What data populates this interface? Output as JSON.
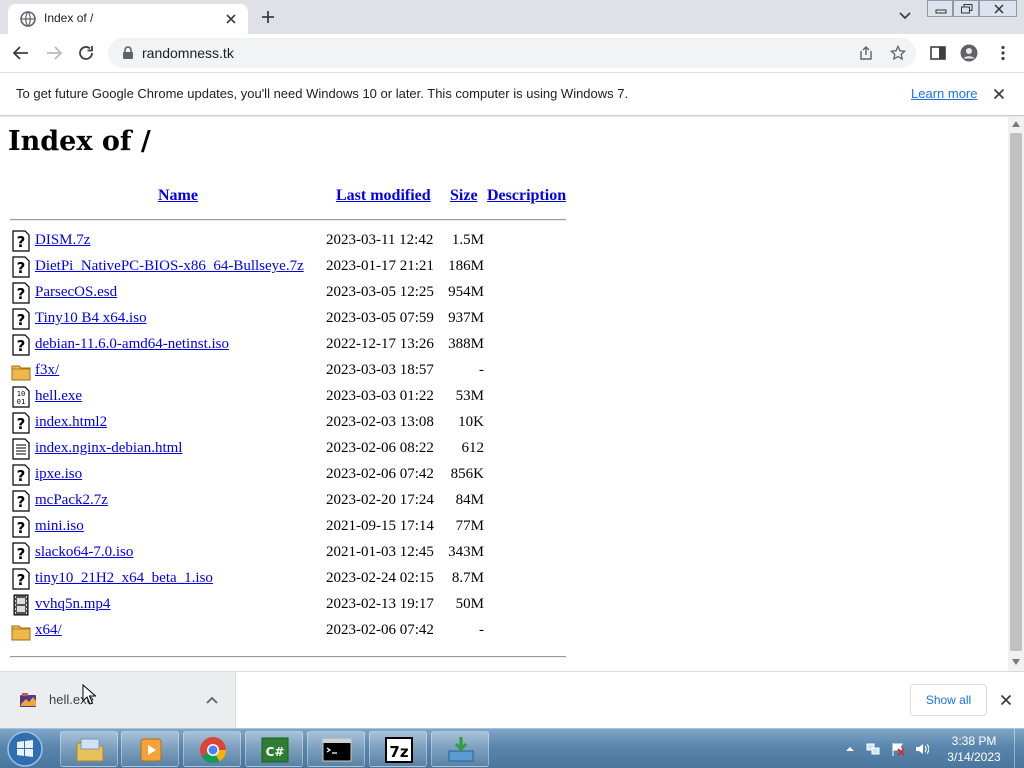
{
  "browser": {
    "tab": {
      "title": "Index of /",
      "favicon": "globe-icon"
    },
    "address_bar": {
      "url": "randomness.tk"
    }
  },
  "infobar": {
    "message": "To get future Google Chrome updates, you'll need Windows 10 or later. This computer is using Windows 7.",
    "link": "Learn more"
  },
  "page": {
    "heading": "Index of /",
    "columns": {
      "name": "Name",
      "last_modified": "Last modified",
      "size": "Size",
      "description": "Description"
    },
    "files": [
      {
        "icon": "unknown-file-icon",
        "name": "DISM.7z",
        "modified": "2023-03-11 12:42",
        "size": "1.5M"
      },
      {
        "icon": "unknown-file-icon",
        "name": "DietPi_NativePC-BIOS-x86_64-Bullseye.7z",
        "modified": "2023-01-17 21:21",
        "size": "186M"
      },
      {
        "icon": "unknown-file-icon",
        "name": "ParsecOS.esd",
        "modified": "2023-03-05 12:25",
        "size": "954M"
      },
      {
        "icon": "unknown-file-icon",
        "name": "Tiny10 B4 x64.iso",
        "modified": "2023-03-05 07:59",
        "size": "937M"
      },
      {
        "icon": "unknown-file-icon",
        "name": "debian-11.6.0-amd64-netinst.iso",
        "modified": "2022-12-17 13:26",
        "size": "388M"
      },
      {
        "icon": "folder-icon",
        "name": "f3x/",
        "modified": "2023-03-03 18:57",
        "size": "-"
      },
      {
        "icon": "binary-file-icon",
        "name": "hell.exe",
        "modified": "2023-03-03 01:22",
        "size": "53M"
      },
      {
        "icon": "unknown-file-icon",
        "name": "index.html2",
        "modified": "2023-02-03 13:08",
        "size": "10K"
      },
      {
        "icon": "text-file-icon",
        "name": "index.nginx-debian.html",
        "modified": "2023-02-06 08:22",
        "size": "612"
      },
      {
        "icon": "unknown-file-icon",
        "name": "ipxe.iso",
        "modified": "2023-02-06 07:42",
        "size": "856K"
      },
      {
        "icon": "unknown-file-icon",
        "name": "mcPack2.7z",
        "modified": "2023-02-20 17:24",
        "size": "84M"
      },
      {
        "icon": "unknown-file-icon",
        "name": "mini.iso",
        "modified": "2021-09-15 17:14",
        "size": "77M"
      },
      {
        "icon": "unknown-file-icon",
        "name": "slacko64-7.0.iso",
        "modified": "2021-01-03 12:45",
        "size": "343M"
      },
      {
        "icon": "unknown-file-icon",
        "name": "tiny10_21H2_x64_beta_1.iso",
        "modified": "2023-02-24 02:15",
        "size": "8.7M"
      },
      {
        "icon": "movie-file-icon",
        "name": "vvhq5n.mp4",
        "modified": "2023-02-13 19:17",
        "size": "50M"
      },
      {
        "icon": "folder-icon",
        "name": "x64/",
        "modified": "2023-02-06 07:42",
        "size": "-"
      }
    ]
  },
  "downloads": {
    "item_name": "hell.exe",
    "show_all_label": "Show all"
  },
  "taskbar": {
    "apps": [
      "explorer-icon",
      "media-player-icon",
      "chrome-icon",
      "csharp-icon",
      "cmd-icon",
      "7zip-icon",
      "installer-icon"
    ],
    "clock_time": "3:38 PM",
    "clock_date": "3/14/2023"
  },
  "colors": {
    "link": "#0000ee",
    "chrome_accent": "#1a73e8",
    "tabstrip_bg": "#dee1e6",
    "taskbar_bg": "#5a86ad"
  }
}
